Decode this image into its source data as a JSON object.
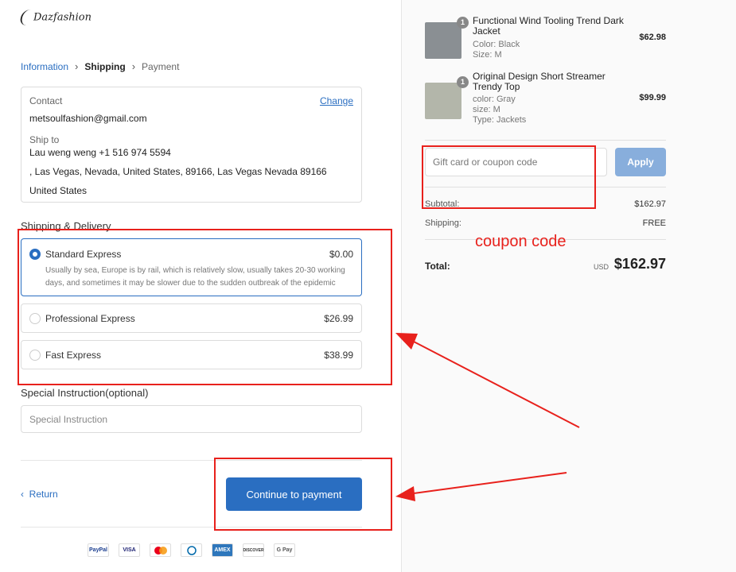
{
  "brand": {
    "logo_text": "Dazfashion"
  },
  "breadcrumb": {
    "step1": "Information",
    "step2": "Shipping",
    "step3": "Payment"
  },
  "contact": {
    "contact_label": "Contact",
    "change_label": "Change",
    "email": "metsoulfashion@gmail.com",
    "ship_to_label": "Ship to",
    "name_phone": "Lau weng weng +1 516 974 5594",
    "address": ", Las Vegas, Nevada, United States, 89166, Las Vegas Nevada 89166",
    "country": "United States"
  },
  "shipping": {
    "title": "Shipping & Delivery",
    "options": [
      {
        "name": "Standard Express",
        "price": "$0.00",
        "selected": true,
        "description": "Usually by sea, Europe is by rail, which is relatively slow, usually takes 20-30 working days, and sometimes it may be slower due to the sudden outbreak of the epidemic"
      },
      {
        "name": "Professional Express",
        "price": "$26.99",
        "selected": false
      },
      {
        "name": "Fast Express",
        "price": "$38.99",
        "selected": false
      }
    ]
  },
  "special": {
    "title": "Special Instruction(optional)",
    "placeholder": "Special Instruction"
  },
  "actions": {
    "return_label": "Return",
    "continue_label": "Continue to payment"
  },
  "payment_methods": [
    "PayPal",
    "VISA",
    "MC",
    "DC",
    "AMEX",
    "DISCOVER",
    "G Pay"
  ],
  "cart": {
    "items": [
      {
        "qty": "1",
        "title": "Functional Wind Tooling Trend Dark Jacket",
        "attrs": [
          "Color: Black",
          "Size: M"
        ],
        "price": "$62.98"
      },
      {
        "qty": "1",
        "title": "Original Design Short Streamer Trendy Top",
        "attrs": [
          "color: Gray",
          "size: M",
          "Type: Jackets"
        ],
        "price": "$99.99"
      }
    ],
    "coupon_placeholder": "Gift card or coupon code",
    "apply_label": "Apply",
    "subtotal_label": "Subtotal:",
    "subtotal": "$162.97",
    "shipping_label": "Shipping:",
    "shipping": "FREE",
    "total_label": "Total:",
    "currency": "USD",
    "total": "$162.97"
  },
  "annotations": {
    "coupon_note": "coupon code",
    "color": "#e8211c"
  }
}
